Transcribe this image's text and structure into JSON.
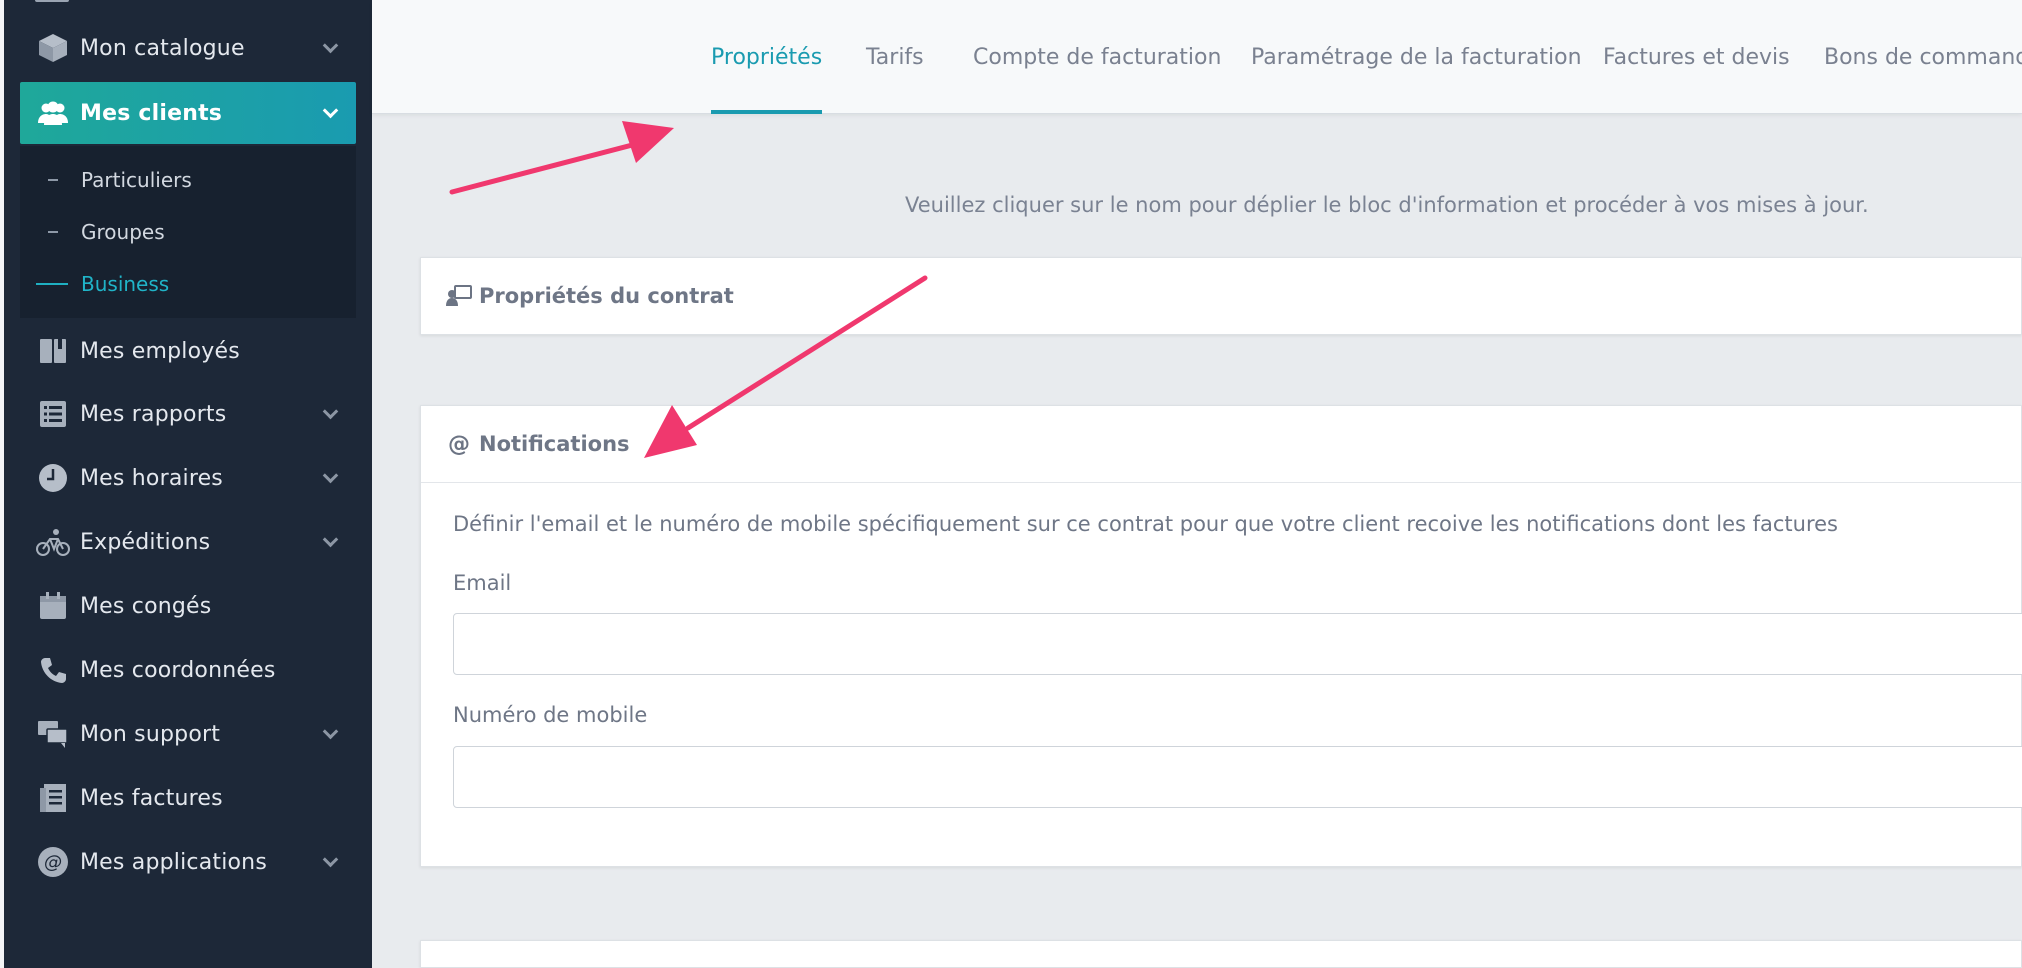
{
  "sidebar": {
    "items": [
      {
        "label": "Mon catalogue",
        "icon": "cube-icon",
        "chevron": true
      },
      {
        "label": "Mes clients",
        "icon": "users-icon",
        "chevron": true,
        "active": true
      },
      {
        "label": "Mes employés",
        "icon": "book-icon",
        "chevron": false
      },
      {
        "label": "Mes rapports",
        "icon": "list-icon",
        "chevron": true
      },
      {
        "label": "Mes horaires",
        "icon": "clock-icon",
        "chevron": true
      },
      {
        "label": "Expéditions",
        "icon": "bicycle-icon",
        "chevron": true
      },
      {
        "label": "Mes congés",
        "icon": "calendar-icon",
        "chevron": false
      },
      {
        "label": "Mes coordonnées",
        "icon": "phone-icon",
        "chevron": false
      },
      {
        "label": "Mon support",
        "icon": "chat-icon",
        "chevron": true
      },
      {
        "label": "Mes factures",
        "icon": "invoice-icon",
        "chevron": false
      },
      {
        "label": "Mes applications",
        "icon": "at-icon",
        "chevron": true
      }
    ],
    "submenu": [
      {
        "label": "Particuliers"
      },
      {
        "label": "Groupes"
      },
      {
        "label": "Business",
        "current": true
      }
    ]
  },
  "tabs": [
    {
      "label": "Propriétés",
      "active": true
    },
    {
      "label": "Tarifs"
    },
    {
      "label": "Compte de facturation"
    },
    {
      "label": "Paramétrage de la facturation"
    },
    {
      "label": "Factures et devis"
    },
    {
      "label": "Bons de commande"
    }
  ],
  "main": {
    "info": "Veuillez cliquer sur le nom pour déplier le bloc d'information et procéder à vos mises à jour.",
    "contract_panel": {
      "title": "Propriétés du contrat"
    },
    "notifications_panel": {
      "title": "Notifications",
      "icon_glyph": "@",
      "description": "Définir l'email et le numéro de mobile spécifiquement sur ce contrat pour que votre client recoive les notifications dont les factures",
      "email_label": "Email",
      "email_value": "",
      "mobile_label": "Numéro de mobile",
      "mobile_value": ""
    }
  },
  "colors": {
    "sidebar_bg": "#1d2838",
    "accent": "#1a9bb0",
    "annotation_arrow": "#f0386e"
  }
}
